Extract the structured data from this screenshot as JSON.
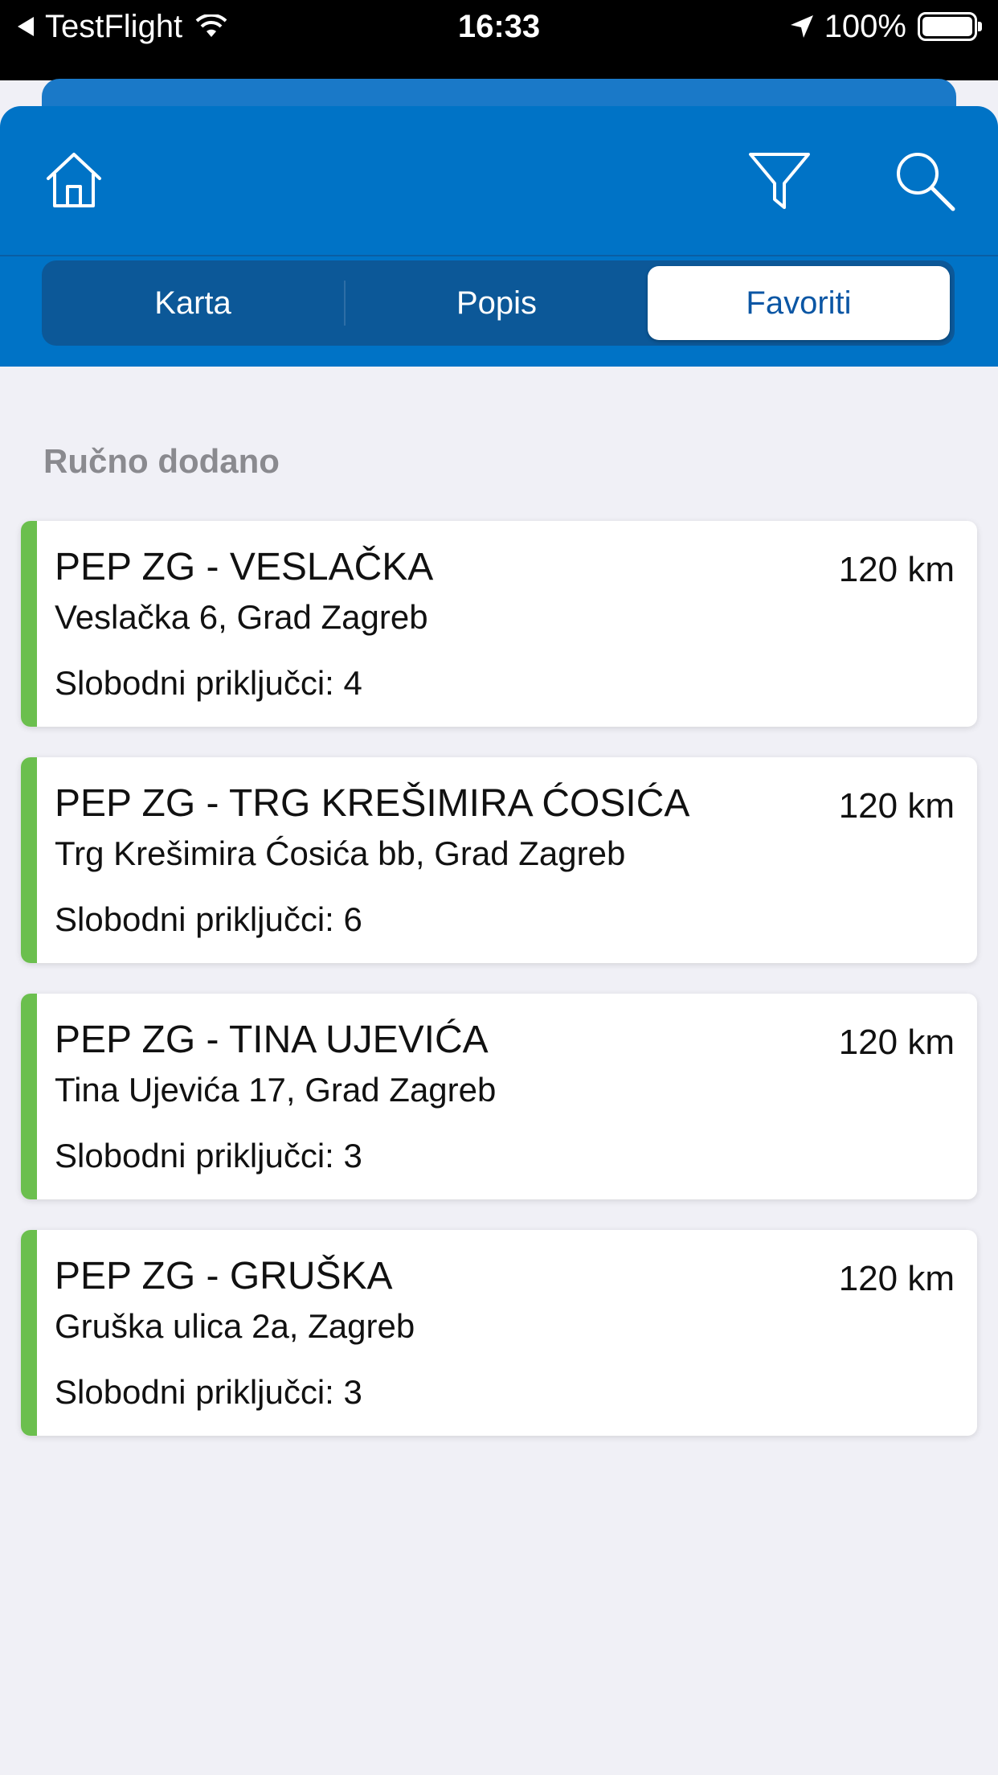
{
  "status_bar": {
    "back_app": "TestFlight",
    "time": "16:33",
    "battery": "100%"
  },
  "header": {
    "icons": [
      "home-icon",
      "filter-icon",
      "search-icon"
    ]
  },
  "tabs": [
    {
      "label": "Karta",
      "active": false
    },
    {
      "label": "Popis",
      "active": false
    },
    {
      "label": "Favoriti",
      "active": true
    }
  ],
  "section": {
    "label": "Ručno dodano"
  },
  "stations": [
    {
      "name": "PEP ZG - VESLAČKA",
      "address": "Veslačka 6, Grad Zagreb",
      "free": "Slobodni priključci: 4",
      "distance": "120 km"
    },
    {
      "name": "PEP ZG - TRG KREŠIMIRA ĆOSIĆA",
      "address": "Trg Krešimira Ćosića bb, Grad Zagreb",
      "free": "Slobodni priključci: 6",
      "distance": "120 km"
    },
    {
      "name": "PEP ZG - TINA UJEVIĆA",
      "address": "Tina Ujevića 17, Grad Zagreb",
      "free": "Slobodni priključci: 3",
      "distance": "120 km"
    },
    {
      "name": "PEP ZG - GRUŠKA",
      "address": "Gruška ulica 2a, Zagreb",
      "free": "Slobodni priključci: 3",
      "distance": "120 km"
    }
  ],
  "colors": {
    "header": "#0073c6",
    "segment_bg": "#0c5898",
    "active_tab_text": "#0b56a4",
    "accent_green": "#6bbf4e",
    "background": "#f0f0f6"
  }
}
